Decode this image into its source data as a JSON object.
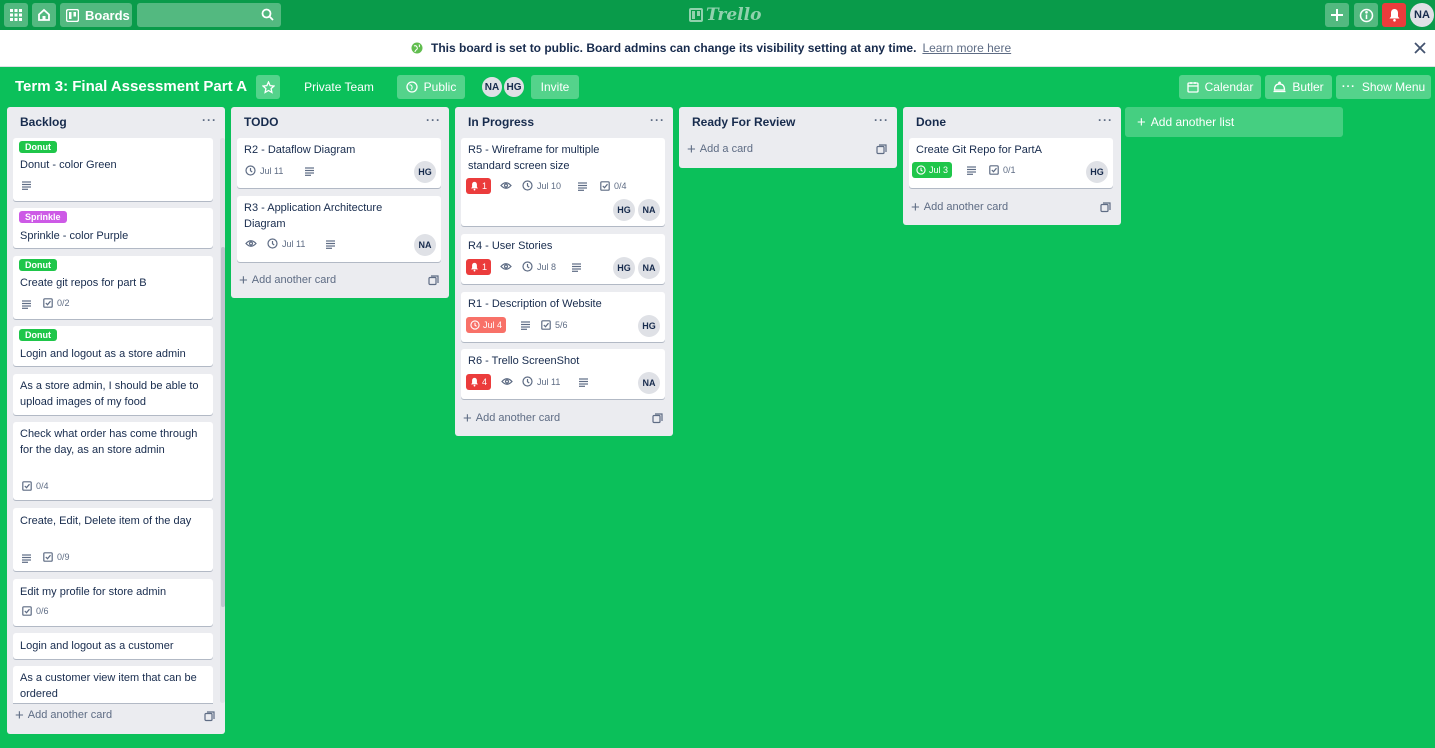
{
  "nav": {
    "boards_label": "Boards",
    "logo_text": "Trello",
    "user_initials": "NA"
  },
  "banner": {
    "text": "This board is set to public. Board admins can change its visibility setting at any time.",
    "link": "Learn more here"
  },
  "board": {
    "title": "Term 3: Final Assessment Part A",
    "team": "Private Team",
    "visibility": "Public",
    "members": [
      "NA",
      "HG"
    ],
    "invite": "Invite",
    "calendar": "Calendar",
    "butler": "Butler",
    "show_menu": "Show Menu"
  },
  "colors": {
    "background": "#0bc05a",
    "label_green": "#1fc64a",
    "label_purple": "#cd5ae6",
    "overdue": "#f87168",
    "due_complete": "#1fc64a",
    "notification_red": "#eb3c3c"
  },
  "lists": [
    {
      "title": "Backlog",
      "add_label": "Add another card",
      "cards": [
        {
          "label": "Donut",
          "title": "Donut - color Green"
        },
        {
          "label": "Sprinkle",
          "title": "Sprinkle - color Purple"
        },
        {
          "label": "Donut",
          "title": "Create git repos for part B",
          "checklist": "0/2"
        },
        {
          "label": "Donut",
          "title": "Login and logout as a store admin"
        },
        {
          "title": "As a store admin, I should be able to upload images of my food"
        },
        {
          "title": "Check what order has come through for the day, as an store admin",
          "checklist": "0/4"
        },
        {
          "title": "Create, Edit, Delete item of the day",
          "checklist": "0/9"
        },
        {
          "title": "Edit my profile for store admin",
          "checklist": "0/6"
        },
        {
          "title": "Login and logout as a customer"
        },
        {
          "title": "As a customer view item that can be ordered"
        }
      ]
    },
    {
      "title": "TODO",
      "add_label": "Add another card",
      "cards": [
        {
          "title": "R2 - Dataflow Diagram",
          "due": "Jul 11",
          "members": [
            "HG"
          ]
        },
        {
          "title": "R3 - Application Architecture Diagram",
          "due": "Jul 11",
          "members": [
            "NA"
          ]
        }
      ]
    },
    {
      "title": "In Progress",
      "add_label": "Add another card",
      "cards": [
        {
          "title": "R5 - Wireframe for multiple standard screen size",
          "notifications": "1",
          "due": "Jul 10",
          "checklist": "0/4",
          "members": [
            "HG",
            "NA"
          ]
        },
        {
          "title": "R4 - User Stories",
          "notifications": "1",
          "due": "Jul 8",
          "members": [
            "HG",
            "NA"
          ]
        },
        {
          "title": "R1 - Description of Website",
          "due": "Jul 4",
          "checklist": "5/6",
          "members": [
            "HG"
          ]
        },
        {
          "title": "R6 - Trello ScreenShot",
          "notifications": "4",
          "due": "Jul 11",
          "members": [
            "NA"
          ]
        }
      ]
    },
    {
      "title": "Ready For Review",
      "add_label": "Add a card",
      "cards": []
    },
    {
      "title": "Done",
      "add_label": "Add another card",
      "cards": [
        {
          "title": "Create Git Repo for PartA",
          "due": "Jul 3",
          "checklist": "0/1",
          "members": [
            "HG"
          ]
        }
      ]
    }
  ],
  "add_list_label": "Add another list",
  "icons": [
    "apps-icon",
    "home-icon",
    "boards-icon",
    "search-icon",
    "plus-icon",
    "info-icon",
    "bell-icon",
    "globe-icon",
    "close-icon",
    "star-icon",
    "calendar-icon",
    "butler-icon",
    "more-icon",
    "clock-icon",
    "eye-icon",
    "description-icon",
    "checklist-icon",
    "template-icon"
  ]
}
